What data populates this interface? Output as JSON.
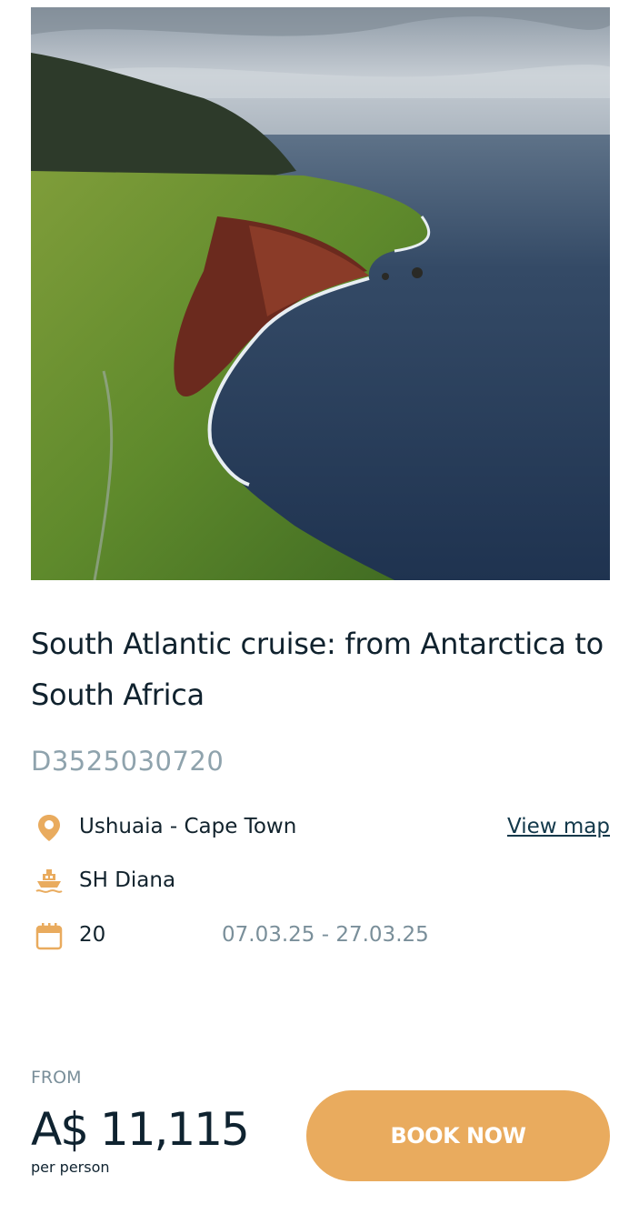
{
  "card": {
    "title": "South Atlantic cruise: from Antarctica to South Africa",
    "code": "D3525030720",
    "route": "Ushuaia - Cape Town",
    "view_map_label": "View map",
    "ship": "SH Diana",
    "nights": "20",
    "dates": "07.03.25 - 27.03.25",
    "from_label": "FROM",
    "price": "A$ 11,115",
    "per_person": "per person",
    "book_label": "BOOK NOW"
  },
  "icons": {
    "route": "map-pin-icon",
    "ship": "ship-icon",
    "duration": "calendar-icon"
  },
  "colors": {
    "accent": "#e9ab5e",
    "text": "#0f2330",
    "muted": "#8fa3ad"
  }
}
